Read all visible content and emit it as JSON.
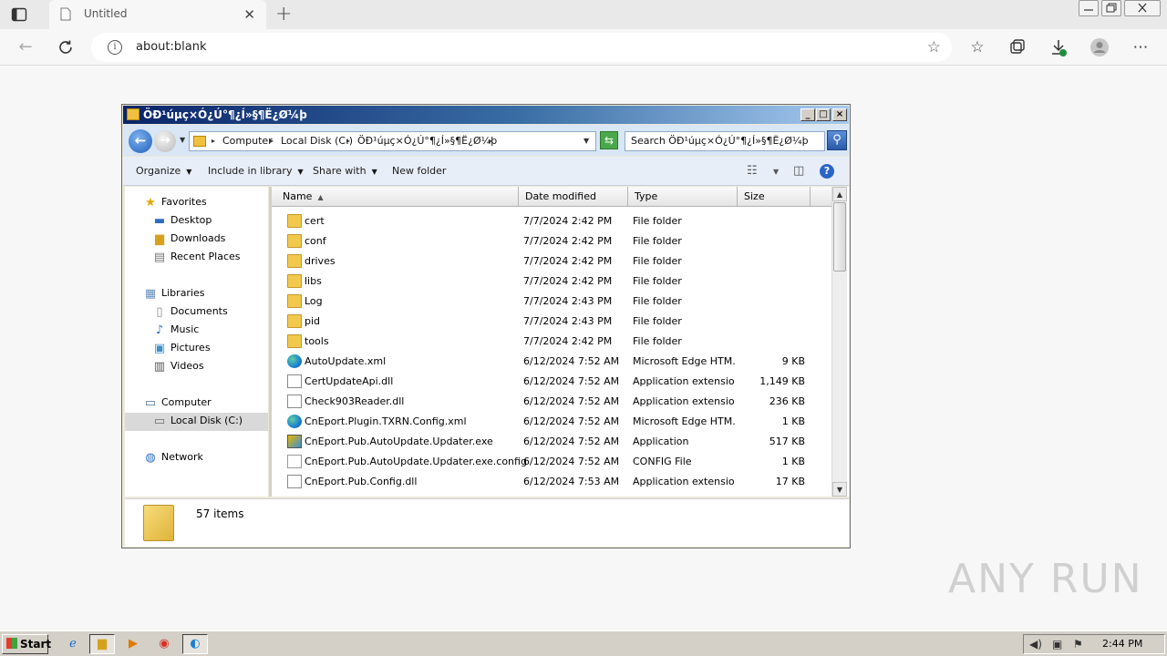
{
  "browser": {
    "tab_title": "Untitled",
    "address": "about:blank",
    "new_tab_symbol": "+",
    "icons": [
      "tab-actions-icon",
      "page-icon",
      "close-tab-icon",
      "new-tab-icon",
      "back-icon",
      "refresh-icon",
      "site-info-icon",
      "add-favorite-icon",
      "favorites-icon",
      "collections-icon",
      "downloads-icon",
      "profile-icon",
      "more-icon"
    ]
  },
  "explorer": {
    "title": "ÖÐ¹úµç×Ó¿Ú°¶¿Í»§¶Ë¿Ø¼þ",
    "breadcrumbs": [
      "Computer",
      "Local Disk (C:)",
      "ÖÐ¹úµç×Ó¿Ú°¶¿Í»§¶Ë¿Ø¼þ"
    ],
    "search_placeholder": "Search ÖÐ¹úµç×Ó¿Ú°¶¿Í»§¶Ë¿Ø¼þ",
    "commands": {
      "organize": "Organize",
      "include_in_library": "Include in library",
      "share_with": "Share with",
      "new_folder": "New folder"
    },
    "nav": {
      "favorites": "Favorites",
      "desktop": "Desktop",
      "downloads": "Downloads",
      "recent_places": "Recent Places",
      "libraries": "Libraries",
      "documents": "Documents",
      "music": "Music",
      "pictures": "Pictures",
      "videos": "Videos",
      "computer": "Computer",
      "local_disk": "Local Disk (C:)",
      "network": "Network"
    },
    "columns": {
      "name": "Name",
      "date": "Date modified",
      "type": "Type",
      "size": "Size"
    },
    "files": [
      {
        "name": "cert",
        "date": "7/7/2024 2:42 PM",
        "type": "File folder",
        "size": "",
        "icon": "folder"
      },
      {
        "name": "conf",
        "date": "7/7/2024 2:42 PM",
        "type": "File folder",
        "size": "",
        "icon": "folder"
      },
      {
        "name": "drives",
        "date": "7/7/2024 2:42 PM",
        "type": "File folder",
        "size": "",
        "icon": "folder"
      },
      {
        "name": "libs",
        "date": "7/7/2024 2:42 PM",
        "type": "File folder",
        "size": "",
        "icon": "folder"
      },
      {
        "name": "Log",
        "date": "7/7/2024 2:43 PM",
        "type": "File folder",
        "size": "",
        "icon": "folder"
      },
      {
        "name": "pid",
        "date": "7/7/2024 2:43 PM",
        "type": "File folder",
        "size": "",
        "icon": "folder"
      },
      {
        "name": "tools",
        "date": "7/7/2024 2:42 PM",
        "type": "File folder",
        "size": "",
        "icon": "folder"
      },
      {
        "name": "AutoUpdate.xml",
        "date": "6/12/2024 7:52 AM",
        "type": "Microsoft Edge HTM...",
        "size": "9 KB",
        "icon": "edge"
      },
      {
        "name": "CertUpdateApi.dll",
        "date": "6/12/2024 7:52 AM",
        "type": "Application extension",
        "size": "1,149 KB",
        "icon": "dll"
      },
      {
        "name": "Check903Reader.dll",
        "date": "6/12/2024 7:52 AM",
        "type": "Application extension",
        "size": "236 KB",
        "icon": "dll"
      },
      {
        "name": "CnEport.Plugin.TXRN.Config.xml",
        "date": "6/12/2024 7:52 AM",
        "type": "Microsoft Edge HTM...",
        "size": "1 KB",
        "icon": "edge"
      },
      {
        "name": "CnEport.Pub.AutoUpdate.Updater.exe",
        "date": "6/12/2024 7:52 AM",
        "type": "Application",
        "size": "517 KB",
        "icon": "exe"
      },
      {
        "name": "CnEport.Pub.AutoUpdate.Updater.exe.config",
        "date": "6/12/2024 7:52 AM",
        "type": "CONFIG File",
        "size": "1 KB",
        "icon": "cfg"
      },
      {
        "name": "CnEport.Pub.Config.dll",
        "date": "6/12/2024 7:53 AM",
        "type": "Application extension",
        "size": "17 KB",
        "icon": "dll"
      }
    ],
    "status": "57 items"
  },
  "taskbar": {
    "start_label": "Start",
    "clock": "2:44 PM"
  },
  "watermark": "ANY RUN"
}
